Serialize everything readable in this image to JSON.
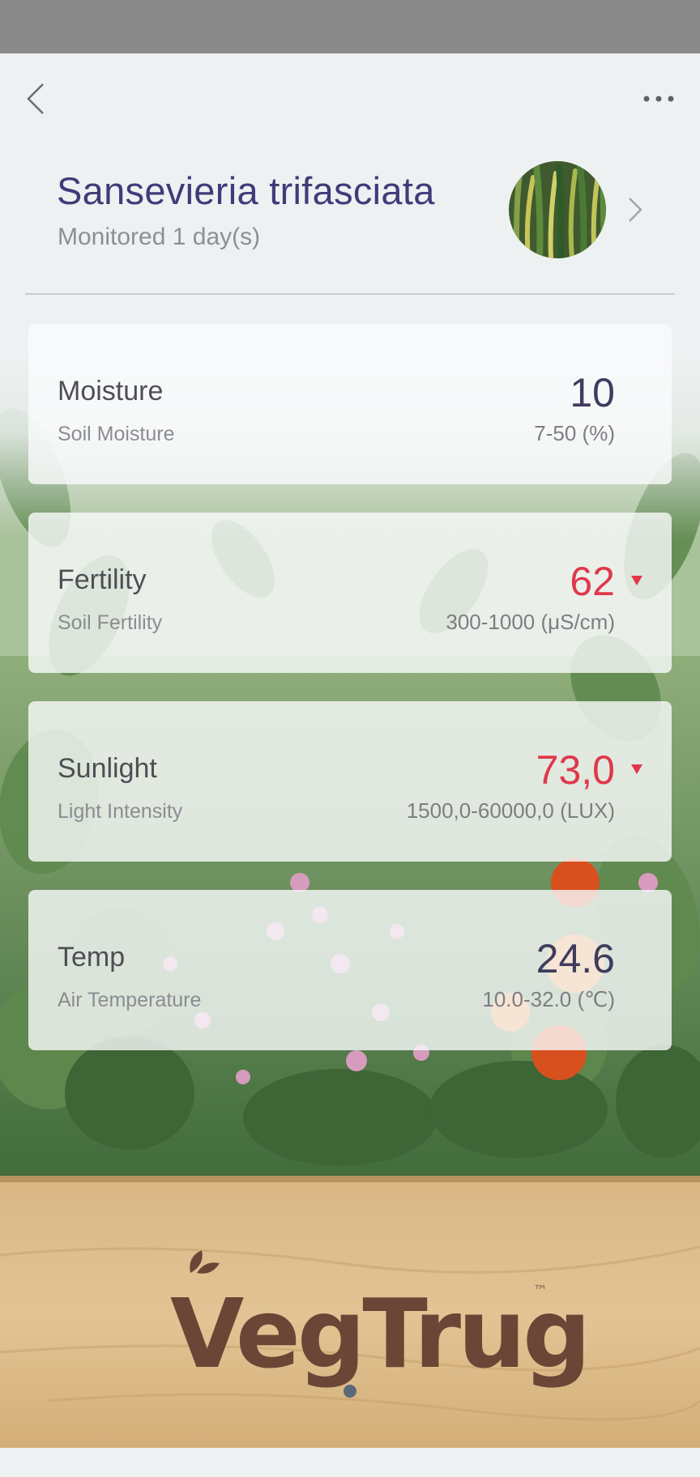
{
  "header": {
    "plant_name": "Sansevieria trifasciata",
    "monitored": "Monitored 1 day(s)"
  },
  "icons": {
    "back": "chevron-left-icon",
    "more": "more-horizontal-icon",
    "plant_chevron": "chevron-right-icon",
    "low_indicator": "triangle-down-icon"
  },
  "cards": [
    {
      "title": "Moisture",
      "subtitle": "Soil Moisture",
      "value": "10",
      "range": "7-50 (%)",
      "status": "normal"
    },
    {
      "title": "Fertility",
      "subtitle": "Soil Fertility",
      "value": "62",
      "range": "300-1000 (μS/cm)",
      "status": "low"
    },
    {
      "title": "Sunlight",
      "subtitle": "Light Intensity",
      "value": "73,0",
      "range": "1500,0-60000,0 (LUX)",
      "status": "low"
    },
    {
      "title": "Temp",
      "subtitle": "Air Temperature",
      "value": "24.6",
      "range": "10.0-32.0 (℃)",
      "status": "normal"
    }
  ],
  "background": {
    "brand_logo": "VegTrug",
    "trademark": "™"
  },
  "colors": {
    "title": "#3f3c7a",
    "alert": "#e0384b",
    "value": "#3f3c5e"
  }
}
